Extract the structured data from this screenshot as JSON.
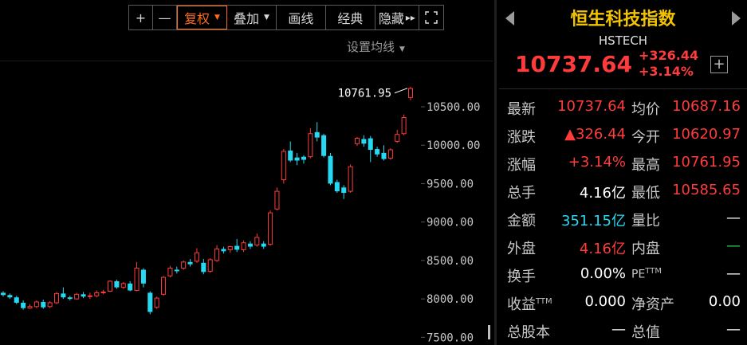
{
  "toolbar": {
    "plus": "+",
    "minus": "—",
    "restore": "复权",
    "overlay": "叠加",
    "draw": "画线",
    "classic": "经典",
    "hide": "隐藏",
    "hide_icon": "▸▸",
    "fullscreen_icon": "expand-icon"
  },
  "settings_label": "设置均线",
  "chart_data": {
    "type": "candlestick",
    "y_axis_ticks": [
      "10500.00",
      "10000.00",
      "9500.00",
      "9000.00",
      "8500.00",
      "8000.00",
      "7500.00"
    ],
    "y_tick_values": [
      10500,
      10000,
      9500,
      9000,
      8500,
      8000,
      7500
    ],
    "ylim": [
      7400,
      11060
    ],
    "max_annotation": "10761.95",
    "colors": {
      "up": "#ff3b3b",
      "down": "#27d8f2"
    },
    "candles": [
      {
        "o": 8080,
        "c": 8050,
        "h": 8100,
        "l": 8030
      },
      {
        "o": 8050,
        "c": 8020,
        "h": 8070,
        "l": 8000
      },
      {
        "o": 8020,
        "c": 7950,
        "h": 8040,
        "l": 7930
      },
      {
        "o": 7950,
        "c": 7880,
        "h": 7980,
        "l": 7860
      },
      {
        "o": 7880,
        "c": 7900,
        "h": 7930,
        "l": 7870
      },
      {
        "o": 7900,
        "c": 7960,
        "h": 7980,
        "l": 7880
      },
      {
        "o": 7960,
        "c": 7890,
        "h": 7990,
        "l": 7870
      },
      {
        "o": 7900,
        "c": 7950,
        "h": 7970,
        "l": 7880
      },
      {
        "o": 7950,
        "c": 8070,
        "h": 8090,
        "l": 7930
      },
      {
        "o": 8070,
        "c": 8020,
        "h": 8150,
        "l": 8000
      },
      {
        "o": 8020,
        "c": 8000,
        "h": 8040,
        "l": 7980
      },
      {
        "o": 8000,
        "c": 8060,
        "h": 8080,
        "l": 7990
      },
      {
        "o": 8060,
        "c": 8030,
        "h": 8090,
        "l": 8010
      },
      {
        "o": 8030,
        "c": 8040,
        "h": 8080,
        "l": 8000
      },
      {
        "o": 8040,
        "c": 8080,
        "h": 8110,
        "l": 8020
      },
      {
        "o": 8080,
        "c": 8090,
        "h": 8120,
        "l": 8060
      },
      {
        "o": 8100,
        "c": 8230,
        "h": 8240,
        "l": 8090
      },
      {
        "o": 8230,
        "c": 8150,
        "h": 8250,
        "l": 8130
      },
      {
        "o": 8150,
        "c": 8200,
        "h": 8220,
        "l": 8130
      },
      {
        "o": 8200,
        "c": 8110,
        "h": 8230,
        "l": 8100
      },
      {
        "o": 8110,
        "c": 8400,
        "h": 8480,
        "l": 8100
      },
      {
        "o": 8380,
        "c": 8200,
        "h": 8400,
        "l": 8150
      },
      {
        "o": 8080,
        "c": 7830,
        "h": 8100,
        "l": 7800
      },
      {
        "o": 7890,
        "c": 8010,
        "h": 8030,
        "l": 7870
      },
      {
        "o": 8060,
        "c": 8280,
        "h": 8300,
        "l": 8040
      },
      {
        "o": 8300,
        "c": 8400,
        "h": 8430,
        "l": 8280
      },
      {
        "o": 8380,
        "c": 8360,
        "h": 8420,
        "l": 8330
      },
      {
        "o": 8400,
        "c": 8480,
        "h": 8500,
        "l": 8380
      },
      {
        "o": 8480,
        "c": 8450,
        "h": 8520,
        "l": 8420
      },
      {
        "o": 8490,
        "c": 8600,
        "h": 8660,
        "l": 8470
      },
      {
        "o": 8470,
        "c": 8350,
        "h": 8520,
        "l": 8320
      },
      {
        "o": 8360,
        "c": 8510,
        "h": 8530,
        "l": 8340
      },
      {
        "o": 8500,
        "c": 8650,
        "h": 8700,
        "l": 8480
      },
      {
        "o": 8650,
        "c": 8620,
        "h": 8680,
        "l": 8590
      },
      {
        "o": 8640,
        "c": 8680,
        "h": 8690,
        "l": 8600
      },
      {
        "o": 8690,
        "c": 8640,
        "h": 8780,
        "l": 8610
      },
      {
        "o": 8640,
        "c": 8730,
        "h": 8760,
        "l": 8610
      },
      {
        "o": 8720,
        "c": 8680,
        "h": 8750,
        "l": 8650
      },
      {
        "o": 8700,
        "c": 8800,
        "h": 8850,
        "l": 8680
      },
      {
        "o": 8720,
        "c": 8680,
        "h": 8750,
        "l": 8650
      },
      {
        "o": 8710,
        "c": 9120,
        "h": 9150,
        "l": 8690
      },
      {
        "o": 9170,
        "c": 9400,
        "h": 9450,
        "l": 9150
      },
      {
        "o": 9550,
        "c": 9920,
        "h": 9950,
        "l": 9500
      },
      {
        "o": 9930,
        "c": 9800,
        "h": 10050,
        "l": 9780
      },
      {
        "o": 9840,
        "c": 9800,
        "h": 9900,
        "l": 9740
      },
      {
        "o": 9850,
        "c": 9810,
        "h": 9870,
        "l": 9760
      },
      {
        "o": 9850,
        "c": 10150,
        "h": 10220,
        "l": 9830
      },
      {
        "o": 10170,
        "c": 10100,
        "h": 10300,
        "l": 10050
      },
      {
        "o": 10130,
        "c": 9860,
        "h": 10150,
        "l": 9840
      },
      {
        "o": 9860,
        "c": 9500,
        "h": 9900,
        "l": 9480
      },
      {
        "o": 9520,
        "c": 9400,
        "h": 9550,
        "l": 9380
      },
      {
        "o": 9450,
        "c": 9380,
        "h": 9480,
        "l": 9300
      },
      {
        "o": 9400,
        "c": 9720,
        "h": 9750,
        "l": 9380
      },
      {
        "o": 10020,
        "c": 10090,
        "h": 10110,
        "l": 9990
      },
      {
        "o": 10080,
        "c": 10020,
        "h": 10130,
        "l": 9980
      },
      {
        "o": 10090,
        "c": 9940,
        "h": 10120,
        "l": 9780
      },
      {
        "o": 9950,
        "c": 9880,
        "h": 9980,
        "l": 9850
      },
      {
        "o": 9900,
        "c": 9820,
        "h": 10000,
        "l": 9800
      },
      {
        "o": 9830,
        "c": 9940,
        "h": 9960,
        "l": 9810
      },
      {
        "o": 10050,
        "c": 10140,
        "h": 10200,
        "l": 10030
      },
      {
        "o": 10150,
        "c": 10360,
        "h": 10400,
        "l": 10130
      },
      {
        "o": 10620.97,
        "c": 10737.64,
        "h": 10761.95,
        "l": 10585.65
      }
    ]
  },
  "info": {
    "name": "恒生科技指数",
    "code": "HSTECH",
    "price": "10737.64",
    "change": "+326.44",
    "change_pct": "+3.14%",
    "add_icon": "+",
    "rows": [
      {
        "l1": "最新",
        "v1": "10737.64",
        "c1": "red",
        "l2": "均价",
        "v2": "10687.16",
        "c2": "red"
      },
      {
        "l1": "涨跌",
        "v1": "▲326.44",
        "c1": "red",
        "l2": "今开",
        "v2": "10620.97",
        "c2": "red"
      },
      {
        "l1": "涨幅",
        "v1": "+3.14%",
        "c1": "red",
        "l2": "最高",
        "v2": "10761.95",
        "c2": "red"
      },
      {
        "l1": "总手",
        "v1": "4.16亿",
        "c1": "white",
        "l2": "最低",
        "v2": "10585.65",
        "c2": "red"
      },
      {
        "l1": "金额",
        "v1": "351.15亿",
        "c1": "cyan",
        "l2": "量比",
        "v2": "—",
        "c2": "white"
      },
      {
        "l1": "外盘",
        "v1": "4.16亿",
        "c1": "red",
        "l2": "内盘",
        "v2": "—",
        "c2": "green"
      },
      {
        "l1": "换手",
        "v1": "0.00%",
        "c1": "white",
        "l2": "PE",
        "l2sup": "TTM",
        "v2": "—",
        "c2": "white"
      },
      {
        "l1": "收益",
        "l1sup": "TTM",
        "v1": "0.000",
        "c1": "white",
        "l2": "净资产",
        "v2": "0.00",
        "c2": "white"
      },
      {
        "l1": "总股本",
        "v1": "—",
        "c1": "white",
        "l2": "总值",
        "v2": "—",
        "c2": "white"
      }
    ]
  }
}
